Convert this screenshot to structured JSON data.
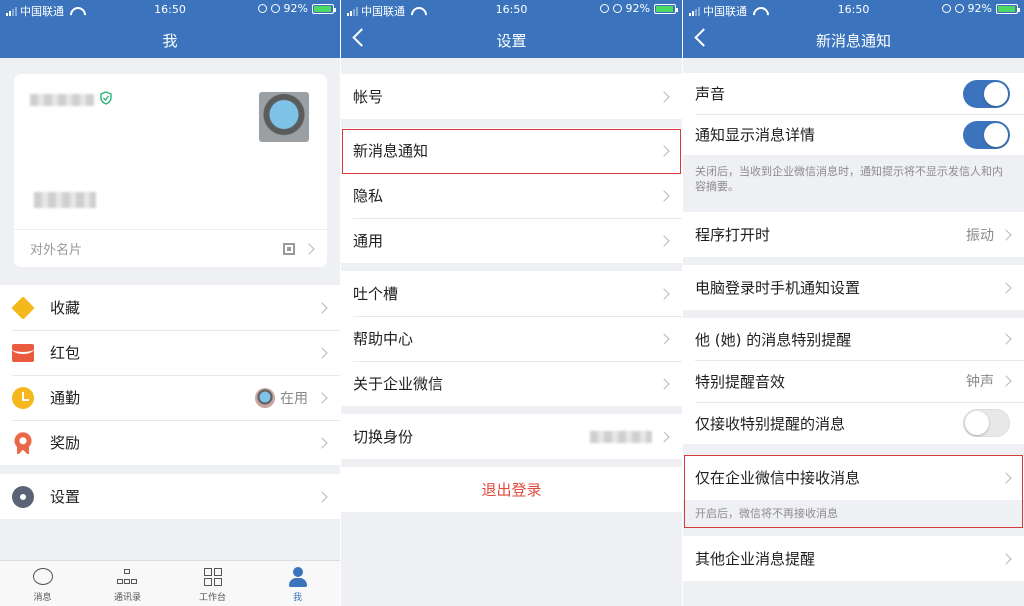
{
  "status_bar": {
    "carrier": "中国联通",
    "time": "16:50",
    "battery": "92%"
  },
  "panel_me": {
    "title": "我",
    "card_footer": "对外名片",
    "menu": [
      {
        "label": "收藏",
        "icon": "favorites-box-icon"
      },
      {
        "label": "红包",
        "icon": "red-envelope-icon"
      },
      {
        "label": "通勤",
        "icon": "clock-icon",
        "value": "在用"
      },
      {
        "label": "奖励",
        "icon": "medal-icon"
      },
      {
        "label": "设置",
        "icon": "gear-icon"
      }
    ],
    "tabs": [
      {
        "label": "消息"
      },
      {
        "label": "通讯录"
      },
      {
        "label": "工作台"
      },
      {
        "label": "我",
        "active": true
      }
    ]
  },
  "panel_settings": {
    "title": "设置",
    "items": [
      "帐号",
      "新消息通知",
      "隐私",
      "通用",
      "吐个槽",
      "帮助中心",
      "关于企业微信",
      "切换身份"
    ],
    "logout": "退出登录"
  },
  "panel_notify": {
    "title": "新消息通知",
    "items": {
      "sound": "声音",
      "show_detail": "通知显示消息详情",
      "detail_note": "关闭后，当收到企业微信消息时，通知提示将不显示发信人和内容摘要。",
      "app_open": "程序打开时",
      "app_open_value": "振动",
      "pc_login": "电脑登录时手机通知设置",
      "special_remind": "他 (她) 的消息特别提醒",
      "special_sound": "特别提醒音效",
      "special_sound_value": "钟声",
      "only_special": "仅接收特别提醒的消息",
      "only_wework": "仅在企业微信中接收消息",
      "only_wework_note": "开启后，微信将不再接收消息",
      "other_corp": "其他企业消息提醒"
    },
    "toggles": {
      "sound": true,
      "show_detail": true,
      "only_special": false
    }
  },
  "colors": {
    "nav_blue": "#3b74bd",
    "highlight_red": "#d63a3a",
    "logout_red": "#e34a3f"
  }
}
